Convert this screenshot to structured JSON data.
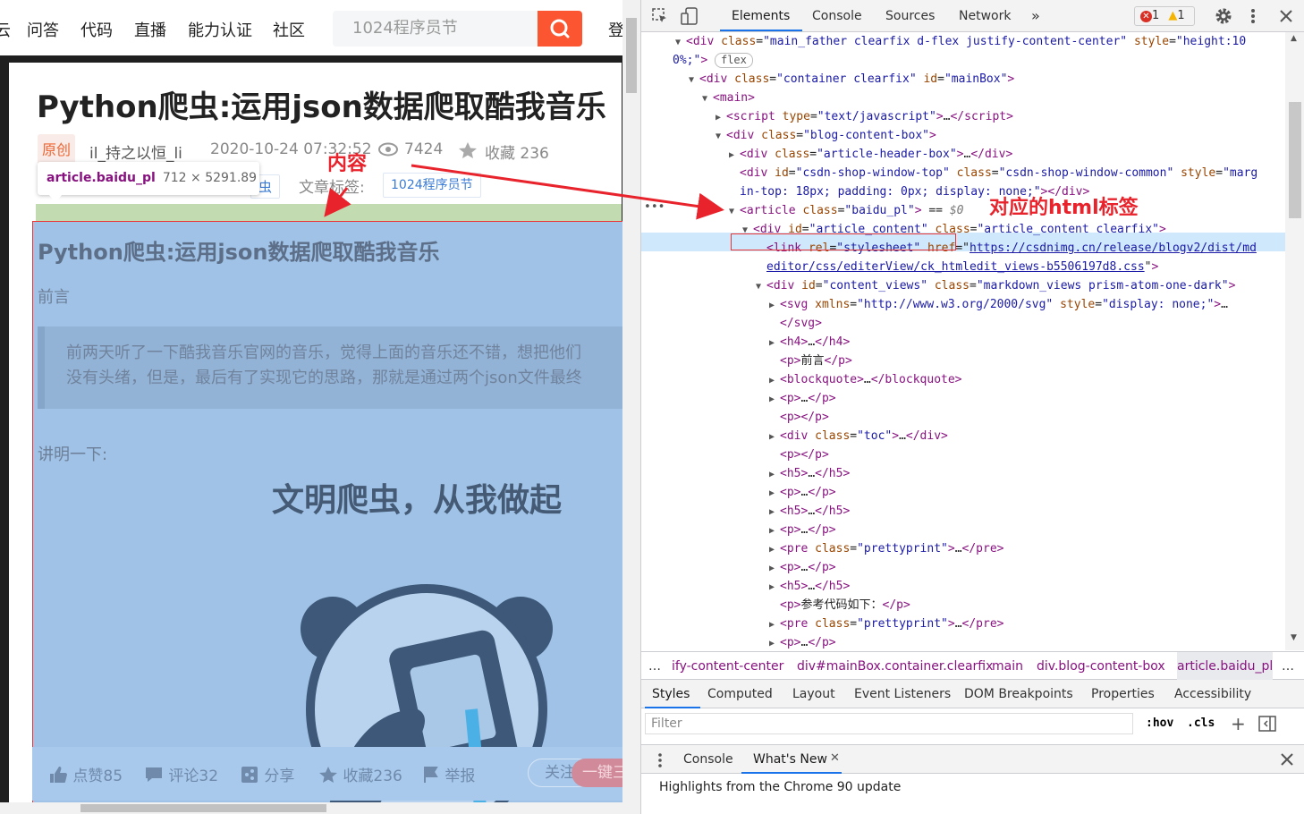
{
  "webpage": {
    "nav": {
      "cut_item": "云",
      "items": [
        "问答",
        "代码",
        "直播",
        "能力认证",
        "社区"
      ],
      "search_placeholder": "1024程序员节",
      "login_cut": "登"
    },
    "article": {
      "title": "Python爬虫:运用json数据爬取酷我音乐",
      "original_badge": "原创",
      "author": "il_持之以恒_li",
      "date": "2020-10-24 07:32:52",
      "views": "7424",
      "collect": "收藏 236",
      "category_cut": "虫",
      "tags_label": "文章标签:",
      "tag": "1024程序员节"
    },
    "inspect_tooltip": {
      "tag": "article.baidu_pl",
      "dims": "712 × 5291.89"
    },
    "content": {
      "title": "Python爬虫:运用json数据爬取酷我音乐",
      "preface": "前言",
      "quote_lines": [
        "前两天听了一下酷我音乐官网的音乐，觉得上面的音乐还不错，想把他们",
        "没有头绪，但是，最后有了实现它的思路，那就是通过两个json文件最终"
      ],
      "explain": "讲明一下:",
      "meme_caption": "文明爬虫，从我做起"
    },
    "actions": {
      "like": "点赞85",
      "comment": "评论32",
      "share": "分享",
      "collect": "收藏236",
      "report": "举报",
      "follow": "关注",
      "onekey": "一键三"
    }
  },
  "annotations": {
    "content_label": "内容",
    "html_tag_label": "对应的html标签"
  },
  "devtools": {
    "tabs": [
      "Elements",
      "Console",
      "Sources",
      "Network"
    ],
    "more_tabs": "»",
    "errors": "1",
    "warnings": "1",
    "dom_lines": [
      {
        "indent": 0,
        "tri": "▼",
        "html": "<span class='tg'>&lt;div</span> <span class='an'>class</span>=<span class='av'>\"main_father clearfix d-flex justify-content-center\"</span> <span class='an'>style</span>=<span class='av'>\"height:10</span>"
      },
      {
        "indent": -1,
        "tri": "",
        "html": "<span class='av'>0%;\"</span><span class='tg'>&gt;</span> <span id='flex-chip'>flex</span>"
      },
      {
        "indent": 1,
        "tri": "▼",
        "html": "<span class='tg'>&lt;div</span> <span class='an'>class</span>=<span class='av'>\"container clearfix\"</span> <span class='an'>id</span>=<span class='av'>\"mainBox\"</span><span class='tg'>&gt;</span>"
      },
      {
        "indent": 2,
        "tri": "▼",
        "html": "<span class='tg'>&lt;main&gt;</span>"
      },
      {
        "indent": 3,
        "tri": "▶",
        "html": "<span class='tg'>&lt;script</span> <span class='an'>type</span>=<span class='av'>\"text/javascript\"</span><span class='tg'>&gt;</span>…<span class='tg'>&lt;/script&gt;</span>"
      },
      {
        "indent": 3,
        "tri": "▼",
        "html": "<span class='tg'>&lt;div</span> <span class='an'>class</span>=<span class='av'>\"blog-content-box\"</span><span class='tg'>&gt;</span>"
      },
      {
        "indent": 4,
        "tri": "▶",
        "html": "<span class='tg'>&lt;div</span> <span class='an'>class</span>=<span class='av'>\"article-header-box\"</span><span class='tg'>&gt;</span>…<span class='tg'>&lt;/div&gt;</span>"
      },
      {
        "indent": 4,
        "tri": "",
        "html": "<span class='tg'>&lt;div</span> <span class='an'>id</span>=<span class='av'>\"csdn-shop-window-top\"</span> <span class='an'>class</span>=<span class='av'>\"csdn-shop-window-common\"</span> <span class='an'>style</span>=<span class='av'>\"marg</span>"
      },
      {
        "indent": 4,
        "tri": "",
        "html": "<span class='av'>in-top: 18px; padding: 0px; display: none;\"</span><span class='tg'>&gt;&lt;/div&gt;</span>"
      },
      {
        "indent": 4,
        "tri": "▼",
        "html": "<span class='tg'>&lt;article</span> <span class='an'>class</span>=<span class='av'>\"baidu_pl\"</span><span class='tg'>&gt;</span> == <i style='color:#777'>$0</i>"
      },
      {
        "indent": 5,
        "tri": "▼",
        "html": "<span class='tg'>&lt;div</span> <span class='an'>id</span>=<span class='av'>\"article_content\"</span> <span class='an'>class</span>=<span class='av'>\"article_content clearfix\"</span><span class='tg'>&gt;</span>"
      },
      {
        "indent": 6,
        "tri": "",
        "html": "<span class='tg'>&lt;link</span> <span class='an'>rel</span>=<span class='av'>\"stylesheet\"</span> <span class='an'>href</span>=\"<span class='lnk'>https://csdnimg.cn/release/blogv2/dist/md</span>"
      },
      {
        "indent": 6,
        "tri": "",
        "html": "<span class='lnk'>editor/css/editerView/ck_htmledit_views-b5506197d8.css</span>\"<span class='tg'>&gt;</span>"
      },
      {
        "indent": 6,
        "tri": "▼",
        "html": "<span class='tg'>&lt;div</span> <span class='an'>id</span>=<span class='av'>\"content_views\"</span> <span class='an'>class</span>=<span class='av'>\"markdown_views prism-atom-one-dark\"</span><span class='tg'>&gt;</span>"
      },
      {
        "indent": 7,
        "tri": "▶",
        "html": "<span class='tg'>&lt;svg</span> <span class='an'>xmlns</span>=<span class='av'>\"http://www.w3.org/2000/svg\"</span> <span class='an'>style</span>=<span class='av'>\"display: none;\"</span><span class='tg'>&gt;</span>…"
      },
      {
        "indent": 7,
        "tri": "",
        "html": "<span class='tg'>&lt;/svg&gt;</span>"
      },
      {
        "indent": 7,
        "tri": "▶",
        "html": "<span class='tg'>&lt;h4&gt;</span>…<span class='tg'>&lt;/h4&gt;</span>"
      },
      {
        "indent": 7,
        "tri": "",
        "html": "<span class='tg'>&lt;p&gt;</span>前言<span class='tg'>&lt;/p&gt;</span>"
      },
      {
        "indent": 7,
        "tri": "▶",
        "html": "<span class='tg'>&lt;blockquote&gt;</span>…<span class='tg'>&lt;/blockquote&gt;</span>"
      },
      {
        "indent": 7,
        "tri": "▶",
        "html": "<span class='tg'>&lt;p&gt;</span>…<span class='tg'>&lt;/p&gt;</span>"
      },
      {
        "indent": 7,
        "tri": "",
        "html": "<span class='tg'>&lt;p&gt;&lt;/p&gt;</span>"
      },
      {
        "indent": 7,
        "tri": "▶",
        "html": "<span class='tg'>&lt;div</span> <span class='an'>class</span>=<span class='av'>\"toc\"</span><span class='tg'>&gt;</span>…<span class='tg'>&lt;/div&gt;</span>"
      },
      {
        "indent": 7,
        "tri": "",
        "html": "<span class='tg'>&lt;p&gt;&lt;/p&gt;</span>"
      },
      {
        "indent": 7,
        "tri": "▶",
        "html": "<span class='tg'>&lt;h5&gt;</span>…<span class='tg'>&lt;/h5&gt;</span>"
      },
      {
        "indent": 7,
        "tri": "▶",
        "html": "<span class='tg'>&lt;p&gt;</span>…<span class='tg'>&lt;/p&gt;</span>"
      },
      {
        "indent": 7,
        "tri": "▶",
        "html": "<span class='tg'>&lt;h5&gt;</span>…<span class='tg'>&lt;/h5&gt;</span>"
      },
      {
        "indent": 7,
        "tri": "▶",
        "html": "<span class='tg'>&lt;p&gt;</span>…<span class='tg'>&lt;/p&gt;</span>"
      },
      {
        "indent": 7,
        "tri": "▶",
        "html": "<span class='tg'>&lt;pre</span> <span class='an'>class</span>=<span class='av'>\"prettyprint\"</span><span class='tg'>&gt;</span>…<span class='tg'>&lt;/pre&gt;</span>"
      },
      {
        "indent": 7,
        "tri": "▶",
        "html": "<span class='tg'>&lt;p&gt;</span>…<span class='tg'>&lt;/p&gt;</span>"
      },
      {
        "indent": 7,
        "tri": "▶",
        "html": "<span class='tg'>&lt;h5&gt;</span>…<span class='tg'>&lt;/h5&gt;</span>"
      },
      {
        "indent": 7,
        "tri": "",
        "html": "<span class='tg'>&lt;p&gt;</span>参考代码如下：<span class='tg'>&lt;/p&gt;</span>"
      },
      {
        "indent": 7,
        "tri": "▶",
        "html": "<span class='tg'>&lt;pre</span> <span class='an'>class</span>=<span class='av'>\"prettyprint\"</span><span class='tg'>&gt;</span>…<span class='tg'>&lt;/pre&gt;</span>"
      },
      {
        "indent": 7,
        "tri": "▶",
        "html": "<span class='tg'>&lt;p&gt;</span>…<span class='tg'>&lt;/p&gt;</span>"
      }
    ],
    "breadcrumbs": [
      "…",
      "ify-content-center",
      "div#mainBox.container.clearfix",
      "main",
      "div.blog-content-box",
      "article.baidu_pl",
      "…"
    ],
    "subtabs": [
      "Styles",
      "Computed",
      "Layout",
      "Event Listeners",
      "DOM Breakpoints",
      "Properties",
      "Accessibility"
    ],
    "filter_placeholder": "Filter",
    "filter_hov": ":hov",
    "filter_cls": ".cls",
    "drawer_tabs": [
      "Console",
      "What's New"
    ],
    "drawer_text": "Highlights from the Chrome 90 update"
  }
}
